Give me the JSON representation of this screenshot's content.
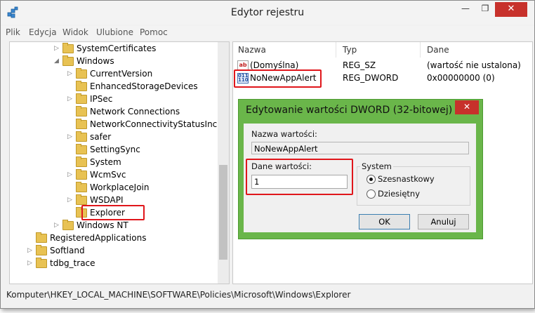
{
  "window": {
    "title": "Edytor rejestru",
    "minimize_glyph": "—",
    "maximize_glyph": "❐",
    "close_glyph": "✕",
    "icon": "regedit-icon"
  },
  "menu": [
    "Plik",
    "Edycja",
    "Widok",
    "Ulubione",
    "Pomoc"
  ],
  "tree": [
    {
      "label": "SystemCertificates",
      "level": 4,
      "arrow": "▷"
    },
    {
      "label": "Windows",
      "level": 4,
      "arrow": "◢"
    },
    {
      "label": "CurrentVersion",
      "level": 5,
      "arrow": "▷"
    },
    {
      "label": "EnhancedStorageDevices",
      "level": 5,
      "arrow": ""
    },
    {
      "label": "IPSec",
      "level": 5,
      "arrow": "▷"
    },
    {
      "label": "Network Connections",
      "level": 5,
      "arrow": ""
    },
    {
      "label": "NetworkConnectivityStatusInc",
      "level": 5,
      "arrow": ""
    },
    {
      "label": "safer",
      "level": 5,
      "arrow": "▷"
    },
    {
      "label": "SettingSync",
      "level": 5,
      "arrow": ""
    },
    {
      "label": "System",
      "level": 5,
      "arrow": ""
    },
    {
      "label": "WcmSvc",
      "level": 5,
      "arrow": "▷"
    },
    {
      "label": "WorkplaceJoin",
      "level": 5,
      "arrow": ""
    },
    {
      "label": "WSDAPI",
      "level": 5,
      "arrow": "▷"
    },
    {
      "label": "Explorer",
      "level": 5,
      "arrow": "",
      "selected": true
    },
    {
      "label": "Windows NT",
      "level": 4,
      "arrow": "▷"
    },
    {
      "label": "RegisteredApplications",
      "level": 2,
      "arrow": ""
    },
    {
      "label": "Softland",
      "level": 2,
      "arrow": "▷"
    },
    {
      "label": "tdbg_trace",
      "level": 2,
      "arrow": "▷"
    }
  ],
  "list": {
    "headers": {
      "name": "Nazwa",
      "type": "Typ",
      "data": "Dane"
    },
    "rows": [
      {
        "icon": "string-value-icon",
        "icon_text": "ab",
        "name": "(Domyślna)",
        "type": "REG_SZ",
        "data": "(wartość nie ustalona)"
      },
      {
        "icon": "binary-value-icon",
        "icon_text": "011 110",
        "name": "NoNewAppAlert",
        "type": "REG_DWORD",
        "data": "0x00000000 (0)"
      }
    ]
  },
  "statusbar": {
    "path": "Komputer\\HKEY_LOCAL_MACHINE\\SOFTWARE\\Policies\\Microsoft\\Windows\\Explorer"
  },
  "dialog": {
    "title": "Edytowanie wartości DWORD (32-bitowej)",
    "close_glyph": "✕",
    "name_label": "Nazwa wartości:",
    "name_value": "NoNewAppAlert",
    "data_label": "Dane wartości:",
    "data_value": "1",
    "base_group_label": "System",
    "base_options": [
      "Szesnastkowy",
      "Dziesiętny"
    ],
    "base_selected": "Szesnastkowy",
    "ok_label": "OK",
    "cancel_label": "Anuluj"
  },
  "colors": {
    "dialog_accent": "#6ab64a",
    "highlight": "#e0161b",
    "close": "#c7312b"
  }
}
